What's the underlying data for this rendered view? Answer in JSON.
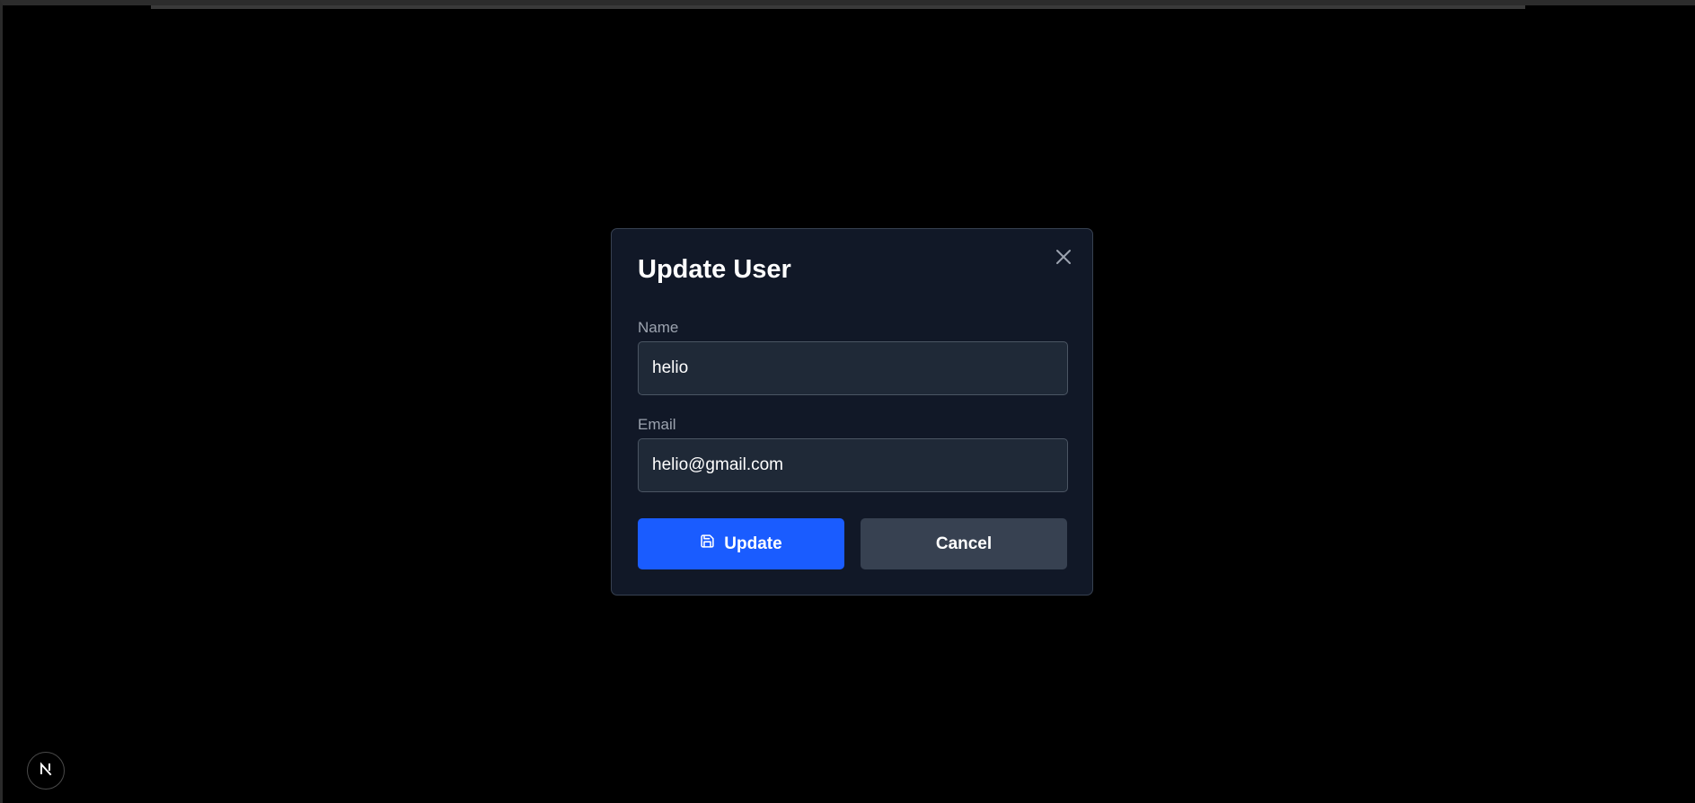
{
  "modal": {
    "title": "Update User",
    "name_label": "Name",
    "name_value": "helio",
    "email_label": "Email",
    "email_value": "helio@gmail.com",
    "update_label": "Update",
    "cancel_label": "Cancel"
  },
  "icons": {
    "close": "close-icon",
    "save": "save-icon",
    "dev_badge": "nextjs-logo-icon"
  },
  "colors": {
    "background": "#000000",
    "modal_bg": "#111827",
    "input_bg": "#1f2937",
    "primary": "#1a5cff",
    "secondary": "#374151",
    "label": "#9ca3af"
  }
}
